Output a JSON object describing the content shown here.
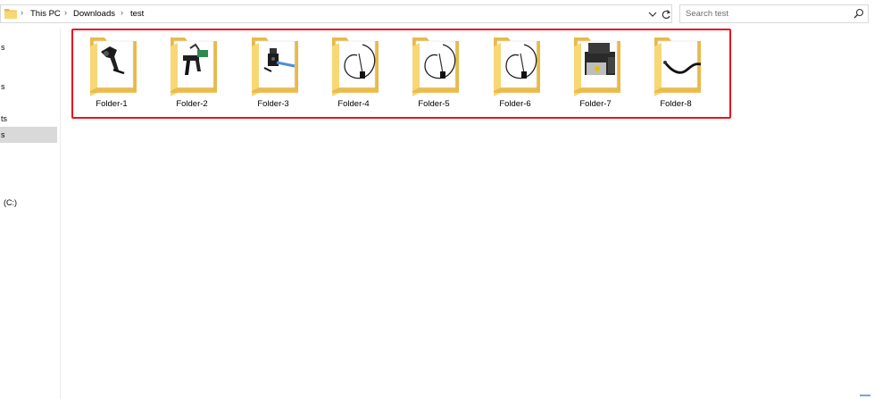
{
  "breadcrumb": {
    "items": [
      "This PC",
      "Downloads",
      "test"
    ]
  },
  "search": {
    "placeholder": "Search test"
  },
  "nav": {
    "items": [
      {
        "label": "s",
        "selected": false
      },
      {
        "label": "s",
        "selected": false
      },
      {
        "label": "ts",
        "selected": false
      },
      {
        "label": "s",
        "selected": true
      },
      {
        "label": "(C:)",
        "selected": false
      }
    ]
  },
  "folders": [
    {
      "name": "Folder-1",
      "thumbnail": "black-lever-arm-part"
    },
    {
      "name": "Folder-2",
      "thumbnail": "black-green-bracket-part"
    },
    {
      "name": "Folder-3",
      "thumbnail": "black-bracket-blue-tube-part"
    },
    {
      "name": "Folder-4",
      "thumbnail": "coiled-wire-sensor"
    },
    {
      "name": "Folder-5",
      "thumbnail": "coiled-wire-sensor"
    },
    {
      "name": "Folder-6",
      "thumbnail": "coiled-wire-sensor"
    },
    {
      "name": "Folder-7",
      "thumbnail": "air-compressor-unit"
    },
    {
      "name": "Folder-8",
      "thumbnail": "curved-black-hose"
    }
  ],
  "colors": {
    "folder_back": "#e9b949",
    "folder_front": "#f8d775",
    "highlight_border": "#e8141f",
    "selected_nav": "#d9d9d9"
  }
}
